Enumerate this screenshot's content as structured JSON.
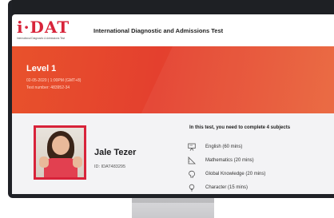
{
  "header": {
    "logo_text": "i·DAT",
    "logo_tagline": "International Diagnostic & Admissions Test",
    "title": "International Diagnostic and Admissions Test"
  },
  "banner": {
    "level": "Level 1",
    "datetime": "02-05-2020 | 1:00PM (GMT+8)",
    "test_number": "Test number: 483952-34"
  },
  "candidate": {
    "name": "Jale Tezer",
    "id": "ID: IDAT483295"
  },
  "subjects": {
    "heading": "In this test, you need to complete 4 subjects",
    "items": [
      {
        "label": "English (60 mins)",
        "icon": "presentation-icon"
      },
      {
        "label": "Mathematics (20 mins)",
        "icon": "ruler-icon"
      },
      {
        "label": "Global Knowledge (20 mins)",
        "icon": "brain-icon"
      },
      {
        "label": "Character (15 mins)",
        "icon": "lightbulb-icon"
      }
    ]
  },
  "colors": {
    "brand": "#d8243a",
    "banner": "#e4402e"
  }
}
